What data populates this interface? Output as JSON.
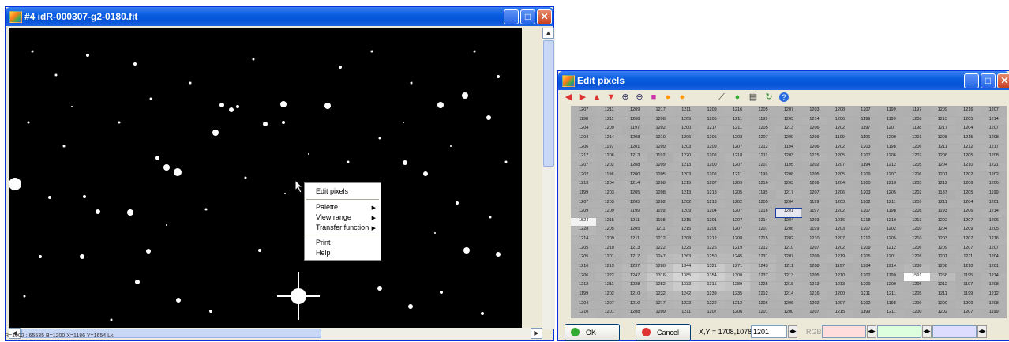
{
  "fit_window": {
    "title": "#4 idR-000307-g2-0180.fit",
    "status": "R=1002 : 65535  B=1200  X=1186  Y=1654 Lk",
    "buttons": {
      "minimize": "_",
      "maximize": "□",
      "close": "✕"
    }
  },
  "context_menu": {
    "items": [
      {
        "label": "Edit pixels",
        "submenu": false
      },
      {
        "label": "Palette",
        "submenu": true
      },
      {
        "label": "View range",
        "submenu": true
      },
      {
        "label": "Transfer function",
        "submenu": true
      },
      {
        "label": "Print",
        "submenu": false
      },
      {
        "label": "Help",
        "submenu": false
      }
    ]
  },
  "edit_window": {
    "title": "Edit pixels",
    "toolbar_icons": [
      "arrow-left-icon",
      "arrow-right-icon",
      "arrow-up-icon",
      "arrow-down-icon",
      "zoom-in-icon",
      "zoom-out-icon",
      "rectangle-icon",
      "orange-circle-icon",
      "orange-circle-2-icon",
      "pen-icon",
      "green-circle-icon",
      "printer-icon",
      "refresh-icon",
      "help-icon"
    ],
    "grid": [
      [
        1207,
        1211,
        1209,
        1217,
        1211,
        1209,
        1216,
        1205,
        1207,
        1203,
        1208,
        1207,
        1199,
        1197,
        1209,
        1216,
        1207
      ],
      [
        1198,
        1211,
        1208,
        1208,
        1209,
        1205,
        1211,
        1199,
        1203,
        1214,
        1206,
        1199,
        1199,
        1208,
        1213,
        1205,
        1214
      ],
      [
        1204,
        1209,
        1197,
        1202,
        1200,
        1217,
        1211,
        1205,
        1213,
        1206,
        1202,
        1197,
        1207,
        1198,
        1217,
        1204,
        1207
      ],
      [
        1204,
        1214,
        1208,
        1210,
        1206,
        1206,
        1203,
        1207,
        1200,
        1209,
        1199,
        1196,
        1209,
        1201,
        1208,
        1215,
        1208
      ],
      [
        1206,
        1197,
        1201,
        1209,
        1203,
        1209,
        1207,
        1212,
        1194,
        1206,
        1202,
        1203,
        1198,
        1206,
        1211,
        1212,
        1217
      ],
      [
        1217,
        1206,
        1213,
        1192,
        1220,
        1202,
        1218,
        1211,
        1203,
        1215,
        1205,
        1207,
        1206,
        1207,
        1206,
        1205,
        1208
      ],
      [
        1207,
        1202,
        1208,
        1209,
        1213,
        1200,
        1207,
        1207,
        1195,
        1202,
        1207,
        1194,
        1212,
        1205,
        1204,
        1210,
        1221
      ],
      [
        1202,
        1196,
        1200,
        1205,
        1203,
        1202,
        1211,
        1199,
        1208,
        1205,
        1205,
        1209,
        1207,
        1206,
        1201,
        1202,
        1202
      ],
      [
        1213,
        1204,
        1214,
        1208,
        1219,
        1207,
        1209,
        1216,
        1203,
        1209,
        1204,
        1200,
        1210,
        1205,
        1212,
        1206,
        1206
      ],
      [
        1199,
        1203,
        1205,
        1208,
        1213,
        1213,
        1205,
        1195,
        1217,
        1207,
        1206,
        1203,
        1205,
        1202,
        1187,
        1205,
        1199
      ],
      [
        1207,
        1203,
        1205,
        1202,
        1202,
        1213,
        1202,
        1205,
        1204,
        1199,
        1203,
        1202,
        1211,
        1209,
        1211,
        1204,
        1201
      ],
      [
        1209,
        1209,
        1199,
        1199,
        1209,
        1204,
        1207,
        1216,
        1201,
        1197,
        1202,
        1207,
        1198,
        1208,
        1193,
        1206,
        1214
      ],
      [
        1524,
        1215,
        1211,
        1198,
        1215,
        1201,
        1207,
        1214,
        1204,
        1203,
        1216,
        1218,
        1210,
        1213,
        1202,
        1207,
        1206
      ],
      [
        1228,
        1205,
        1205,
        1211,
        1215,
        1201,
        1207,
        1207,
        1206,
        1199,
        1203,
        1207,
        1202,
        1210,
        1204,
        1209,
        1205
      ],
      [
        1214,
        1209,
        1211,
        1212,
        1208,
        1212,
        1208,
        1215,
        1202,
        1210,
        1207,
        1212,
        1205,
        1210,
        1203,
        1207,
        1216
      ],
      [
        1205,
        1210,
        1213,
        1222,
        1225,
        1226,
        1219,
        1212,
        1210,
        1207,
        1202,
        1209,
        1212,
        1206,
        1209,
        1207,
        1207
      ],
      [
        1205,
        1201,
        1217,
        1247,
        1263,
        1250,
        1245,
        1231,
        1207,
        1209,
        1219,
        1205,
        1201,
        1208,
        1201,
        1211,
        1204
      ],
      [
        1210,
        1219,
        1237,
        1280,
        1344,
        1321,
        1271,
        1243,
        1211,
        1208,
        1197,
        1204,
        1214,
        1238,
        1208,
        1210,
        1201
      ],
      [
        1206,
        1222,
        1247,
        1316,
        1385,
        1354,
        1300,
        1237,
        1213,
        1205,
        1210,
        1202,
        1199,
        1591,
        1258,
        1195,
        1214
      ],
      [
        1212,
        1211,
        1228,
        1282,
        1333,
        1315,
        1289,
        1225,
        1218,
        1213,
        1213,
        1209,
        1209,
        1206,
        1212,
        1197,
        1208
      ],
      [
        1199,
        1202,
        1210,
        1232,
        1242,
        1239,
        1235,
        1212,
        1214,
        1216,
        1200,
        1211,
        1211,
        1205,
        1211,
        1199,
        1212
      ],
      [
        1204,
        1207,
        1210,
        1217,
        1223,
        1222,
        1212,
        1206,
        1206,
        1202,
        1207,
        1202,
        1198,
        1209,
        1200,
        1209,
        1208
      ],
      [
        1210,
        1201,
        1208,
        1209,
        1211,
        1207,
        1206,
        1201,
        1200,
        1207,
        1215,
        1199,
        1211,
        1200,
        1202,
        1207,
        1199
      ]
    ],
    "selected_value": 1201,
    "ok_label": "OK",
    "cancel_label": "Cancel",
    "xy_label": "X,Y = 1708,1078",
    "value_field": "1201",
    "rgb_label": "RGB ="
  }
}
